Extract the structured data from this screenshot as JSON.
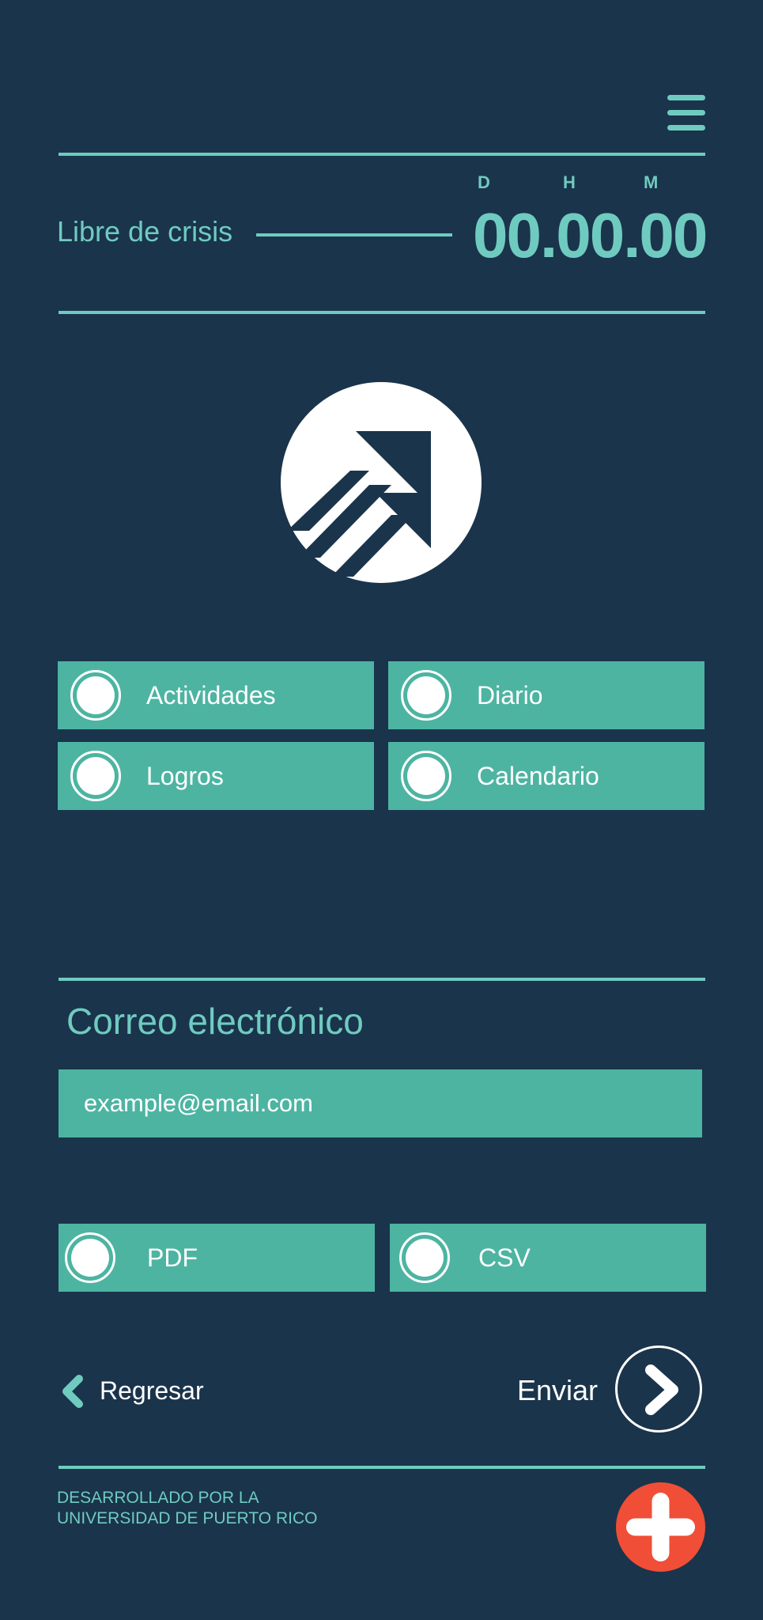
{
  "header": {
    "menu_icon": "hamburger-menu-icon",
    "timer": {
      "label": "Libre de crisis",
      "units": [
        "D",
        "H",
        "M"
      ],
      "value": "00.00.00"
    }
  },
  "logo": {
    "icon": "upward-arrows-logo-icon"
  },
  "options": [
    {
      "label": "Actividades"
    },
    {
      "label": "Diario"
    },
    {
      "label": "Logros"
    },
    {
      "label": "Calendario"
    }
  ],
  "email": {
    "title": "Correo electrónico",
    "placeholder": "example@email.com"
  },
  "formats": [
    {
      "label": "PDF"
    },
    {
      "label": "CSV"
    }
  ],
  "navigation": {
    "back_label": "Regresar",
    "send_label": "Enviar"
  },
  "footer": {
    "line1": "DESARROLLADO POR LA",
    "line2": "UNIVERSIDAD DE PUERTO RICO",
    "add_icon": "plus-icon"
  },
  "colors": {
    "background": "#1a344b",
    "accent": "#6fcbc0",
    "tile": "#4db4a2",
    "action": "#f04e37",
    "text_light": "#ffffff"
  }
}
